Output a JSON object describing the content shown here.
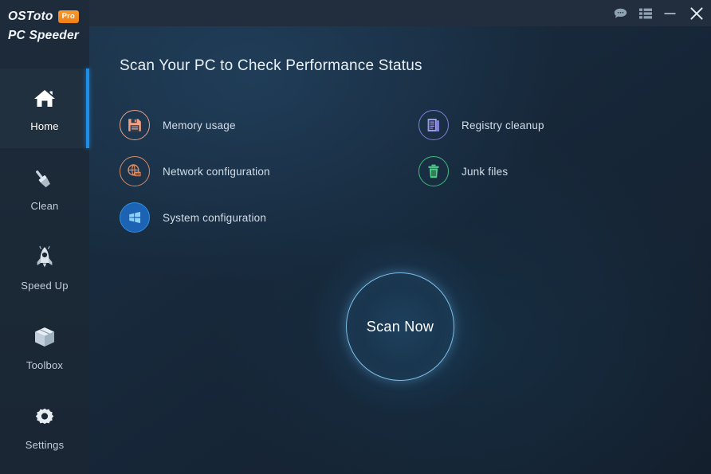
{
  "app": {
    "brand_line1": "OSToto",
    "brand_badge": "Pro",
    "brand_line2": "PC Speeder",
    "accent_color": "#1e8fe8",
    "badge_color": "#ef7f16"
  },
  "titlebar": {
    "feedback_icon": "chat-bubble-icon",
    "menu_icon": "list-menu-icon",
    "minimize_icon": "minimize-icon",
    "close_icon": "close-icon"
  },
  "sidebar": {
    "items": [
      {
        "label": "Home",
        "icon": "home-icon",
        "active": true
      },
      {
        "label": "Clean",
        "icon": "brush-icon",
        "active": false
      },
      {
        "label": "Speed Up",
        "icon": "rocket-icon",
        "active": false
      },
      {
        "label": "Toolbox",
        "icon": "box-icon",
        "active": false
      },
      {
        "label": "Settings",
        "icon": "gear-icon",
        "active": false
      }
    ]
  },
  "main": {
    "title": "Scan Your PC to Check Performance Status",
    "features": [
      {
        "label": "Memory usage",
        "icon": "floppy-disk-icon",
        "color": "#f2a184"
      },
      {
        "label": "Registry cleanup",
        "icon": "registry-document-icon",
        "color": "#8e8ee0"
      },
      {
        "label": "Network configuration",
        "icon": "network-icon",
        "color": "#e08a62"
      },
      {
        "label": "Junk files",
        "icon": "trash-can-icon",
        "color": "#4cd08a"
      },
      {
        "label": "System configuration",
        "icon": "windows-logo-icon",
        "color": "#2f8fe0"
      }
    ],
    "scan_button": "Scan Now"
  }
}
